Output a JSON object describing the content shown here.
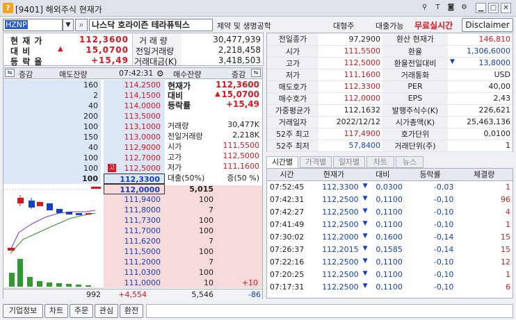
{
  "window": {
    "code_tag": "[9401]",
    "title": "해외주식 현재가"
  },
  "header": {
    "symbol": "HZNP",
    "name": "나스닥  호라이즌 테라퓨틱스",
    "sector": "제약 및 생명공학",
    "category": "대형주",
    "loan": "대출가능",
    "free_label": "무료실시간",
    "disclaimer": "Disclaimer"
  },
  "summary": {
    "price_label": "현 재 가",
    "price": "112,3600",
    "change_label": "대    비",
    "change": "15,0700",
    "rate_label": "등 락 율",
    "rate": "+15,49",
    "volume_label": "거 래 량",
    "volume": "30,477,939",
    "prev_volume_label": "전일거래량",
    "prev_volume": "2,218,458",
    "amount_label": "거래대금(K)",
    "amount": "3,418,503"
  },
  "orderbook": {
    "headers": {
      "chg_left": "증감",
      "ask_qty": "매도잔량",
      "time": "07:42:31",
      "bid_qty": "매수잔량",
      "chg_right": "증감"
    },
    "asks": [
      {
        "qty": "160",
        "price": "114,2500"
      },
      {
        "qty": "2",
        "price": "114,1500"
      },
      {
        "qty": "40",
        "price": "114,0000"
      },
      {
        "qty": "200",
        "price": "113,5000"
      },
      {
        "qty": "100",
        "price": "113,1000"
      },
      {
        "qty": "150",
        "price": "113,0000"
      },
      {
        "qty": "40",
        "price": "112,9000"
      },
      {
        "qty": "100",
        "price": "112,7000"
      },
      {
        "qty": "100",
        "price": "112,5000"
      },
      {
        "qty": "100",
        "price": "112,3300"
      }
    ],
    "bids": [
      {
        "price": "112,0000",
        "qty": "5,015",
        "chg": ""
      },
      {
        "price": "111,9400",
        "qty": "100",
        "chg": ""
      },
      {
        "price": "111,8000",
        "qty": "7",
        "chg": ""
      },
      {
        "price": "111,7300",
        "qty": "100",
        "chg": ""
      },
      {
        "price": "111,7000",
        "qty": "100",
        "chg": ""
      },
      {
        "price": "111,6200",
        "qty": "7",
        "chg": ""
      },
      {
        "price": "111,5000",
        "qty": "100",
        "chg": ""
      },
      {
        "price": "111,2000",
        "qty": "7",
        "chg": ""
      },
      {
        "price": "111,0300",
        "qty": "100",
        "chg": ""
      },
      {
        "price": "111,0000",
        "qty": "10",
        "chg": "+10"
      }
    ],
    "high_marker": "고",
    "info_top": {
      "p_label": "현재가",
      "p": "112,3600",
      "c_label": "대비",
      "c": "15,0700",
      "r_label": "등락률",
      "r": "+15,49"
    },
    "info": [
      {
        "k": "거래량",
        "v": "30,477K"
      },
      {
        "k": "전일거래량",
        "v": "2,218K"
      },
      {
        "k": "시가",
        "v": "111,5500"
      },
      {
        "k": "고가",
        "v": "112,5000"
      },
      {
        "k": "저가",
        "v": "111,1600"
      },
      {
        "k": "대출(50%)",
        "v": "증(50 %)"
      }
    ],
    "totals": {
      "ask_chg": "992",
      "ask": "+4,554",
      "bid": "5,546",
      "bid_chg": "-86"
    }
  },
  "detail": {
    "left": [
      {
        "k": "전일종가",
        "v": "97,2900",
        "c": ""
      },
      {
        "k": "시가",
        "v": "111,5500",
        "c": "red"
      },
      {
        "k": "고가",
        "v": "112,5000",
        "c": "red"
      },
      {
        "k": "저가",
        "v": "111,1600",
        "c": "red"
      },
      {
        "k": "매도호가",
        "v": "112,3300",
        "c": "red"
      },
      {
        "k": "매수호가",
        "v": "112,0000",
        "c": "red"
      },
      {
        "k": "가중평균가",
        "v": "112,1632",
        "c": ""
      },
      {
        "k": "거래일자",
        "v": "2022/12/12",
        "c": ""
      },
      {
        "k": "52주 최고",
        "v": "117,4900",
        "c": "red"
      },
      {
        "k": "52주 최저",
        "v": "57,8400",
        "c": "blue"
      }
    ],
    "right": [
      {
        "k": "환산 현재가",
        "v": "146,810",
        "c": "red"
      },
      {
        "k": "환율",
        "v": "1,306,6000",
        "c": "blue"
      },
      {
        "k": "환율전일대비",
        "v": "13,8000",
        "c": "blue"
      },
      {
        "k": "거래통화",
        "v": "USD",
        "c": ""
      },
      {
        "k": "PER",
        "v": "40,00",
        "c": ""
      },
      {
        "k": "EPS",
        "v": "2,43",
        "c": ""
      },
      {
        "k": "발행주식수(K)",
        "v": "226,621",
        "c": ""
      },
      {
        "k": "시가총액(K)",
        "v": "25,463,136",
        "c": ""
      },
      {
        "k": "호가단위",
        "v": "0,0100",
        "c": ""
      },
      {
        "k": "거래단위(주)",
        "v": "1",
        "c": ""
      }
    ]
  },
  "tabs": [
    "시간별",
    "가격별",
    "일자별",
    "차트",
    "뉴스"
  ],
  "ticks": {
    "headers": [
      "시간",
      "현재가",
      "대비",
      "등락률",
      "체결량"
    ],
    "rows": [
      {
        "t": "07:52:45",
        "p": "112,3300",
        "d": "0,0300",
        "r": "-0,03",
        "q": "1",
        "qc": "red"
      },
      {
        "t": "07:42:31",
        "p": "112,2500",
        "d": "0,1100",
        "r": "-0,10",
        "q": "96",
        "qc": "red"
      },
      {
        "t": "07:42:27",
        "p": "112,2500",
        "d": "0,1100",
        "r": "-0,10",
        "q": "4",
        "qc": "red"
      },
      {
        "t": "07:41:49",
        "p": "112,2500",
        "d": "0,1100",
        "r": "-0,10",
        "q": "1",
        "qc": "red"
      },
      {
        "t": "07:30:02",
        "p": "112,2000",
        "d": "0,1600",
        "r": "-0,14",
        "q": "15",
        "qc": "red"
      },
      {
        "t": "07:26:37",
        "p": "112,2015",
        "d": "0,1585",
        "r": "-0,14",
        "q": "15",
        "qc": "red"
      },
      {
        "t": "07:22:16",
        "p": "112,2500",
        "d": "0,1100",
        "r": "-0,10",
        "q": "12",
        "qc": "red"
      },
      {
        "t": "07:20:25",
        "p": "112,2500",
        "d": "0,1100",
        "r": "-0,10",
        "q": "1",
        "qc": "red"
      },
      {
        "t": "07:17:31",
        "p": "112,2500",
        "d": "0,1100",
        "r": "-0,10",
        "q": "6",
        "qc": "red"
      }
    ]
  },
  "bottom": [
    "기업정보",
    "차트",
    "주문",
    "관심",
    "환전"
  ]
}
